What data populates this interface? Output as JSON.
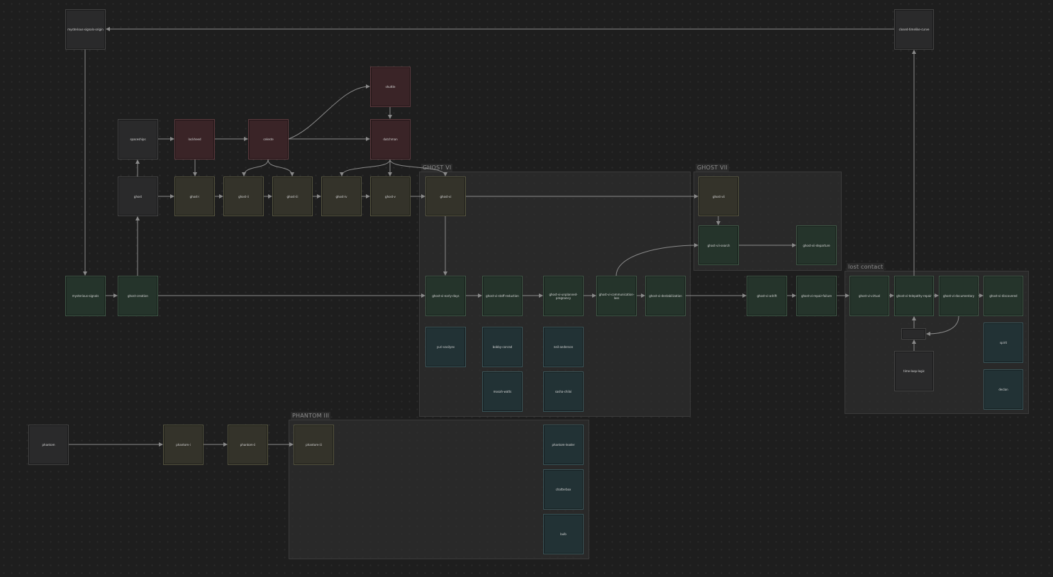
{
  "groups": {
    "ghost_vi": "GHOST VI",
    "ghost_vii": "GHOST VII",
    "phantom_iii": "PHANTOM III",
    "lost_contact": "lost contact"
  },
  "nodes": {
    "mysterious_signals_origin": "mysterious-signals-origin",
    "closed_timelike_curve": "closed-timelike-curve",
    "shuttle": "shuttle",
    "spaceships": "spaceships",
    "lockheed": "lockheed",
    "celeste": "celeste",
    "dutchman": "dutchman",
    "ghost": "ghost",
    "ghost_i": "ghost-i",
    "ghost_ii": "ghost-ii",
    "ghost_iii": "ghost-iii",
    "ghost_iv": "ghost-iv",
    "ghost_v": "ghost-v",
    "ghost_vi": "ghost-vi",
    "ghost_vii": "ghost-vii",
    "ghost_vii_search": "ghost-vii-search",
    "ghost_vii_departure": "ghost-vii-departure",
    "mysterious_signals": "mysterious-signals",
    "ghost_creation": "ghost-creation",
    "ghost_vi_early_days": "ghost-vi-early-days",
    "ghost_vi_staff_reduction": "ghost-vi-staff-reduction",
    "ghost_vi_unplanned_pregnancy": "ghost-vi-unplanned-pregnancy",
    "ghost_vi_communication_loss": "ghost-vi-communication-loss",
    "ghost_vi_destabilization": "ghost-vi-destabilization",
    "ghost_vi_adrift": "ghost-vi-adrift",
    "ghost_vi_repair_failure": "ghost-vi-repair-failure",
    "ghost_vi_virtual": "ghost-vi-virtual",
    "ghost_vi_telepathy_repair": "ghost-vi-telepathy-repair",
    "ghost_vi_documentary": "ghost-vi-documentary",
    "ghost_vi_discovered": "ghost-vi-discovered",
    "yuri_vasilyev": "yuri-vasilyev",
    "bobby_conrad": "bobby-conrad",
    "neil_anderson": "neil-anderson",
    "mosah_watts": "mosah-watts",
    "sasha_chiloi": "sasha-chiloi",
    "time_loop_logic": "time-loop-logic",
    "spirit": "spirit",
    "declan": "declan",
    "phantom": "phantom",
    "phantom_i": "phantom-i",
    "phantom_ii": "phantom-ii",
    "phantom_iii": "phantom-iii",
    "phantom_leader": "phantom-leader",
    "chatterbox": "chatterbox",
    "bulb": "bulb"
  },
  "colors": {
    "gray": "#2a2a2b",
    "red": "#3a2427",
    "olive": "#34332a",
    "green": "#25342b",
    "teal": "#223235",
    "edge": "#8a8a8a"
  }
}
